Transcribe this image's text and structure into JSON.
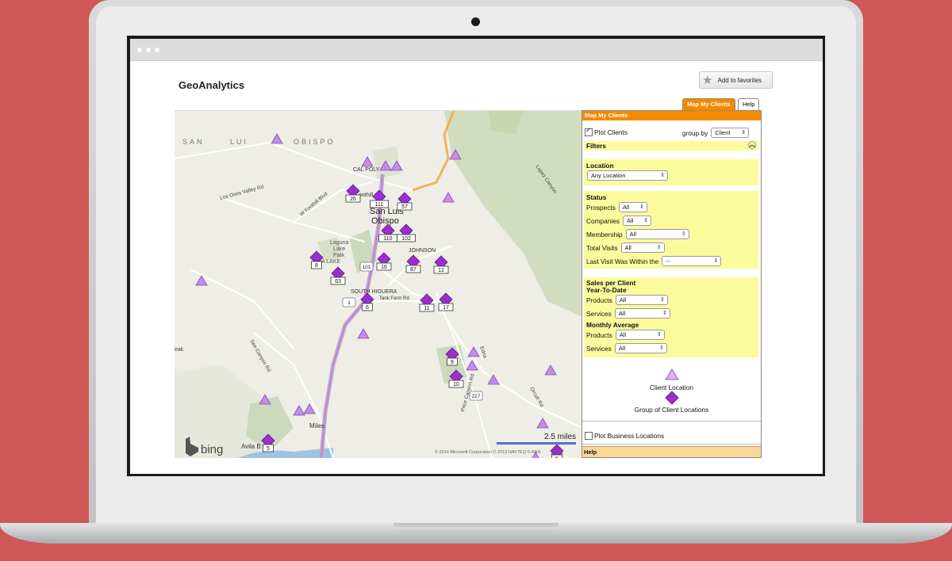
{
  "app": {
    "title": "GeoAnalytics",
    "favorites_label": "Add to favorites"
  },
  "tabs": [
    {
      "label": "Map My Clients"
    },
    {
      "label": "Help"
    }
  ],
  "panel": {
    "header": "Map My Clients",
    "plot_clients": {
      "label": "Plot Clients",
      "checked": true
    },
    "group_by": {
      "label": "group by",
      "value": "Client"
    },
    "filters_title": "Filters",
    "location": {
      "title": "Location",
      "value": "Any Location"
    },
    "status": {
      "title": "Status",
      "prospects": {
        "label": "Prospects",
        "value": "All"
      },
      "companies": {
        "label": "Companies",
        "value": "All"
      },
      "membership": {
        "label": "Membership",
        "value": "All"
      },
      "total_visits": {
        "label": "Total Visits",
        "value": "All"
      },
      "last_visit": {
        "label": "Last Visit Was Within the",
        "value": "--"
      }
    },
    "sales": {
      "title_line1": "Sales per Client",
      "title_line2": "Year-To-Date",
      "products": {
        "label": "Products",
        "value": "All"
      },
      "services": {
        "label": "Services",
        "value": "All"
      },
      "monthly_title": "Monthly Average",
      "m_products": {
        "label": "Products",
        "value": "All"
      },
      "m_services": {
        "label": "Services",
        "value": "All"
      }
    },
    "legend": {
      "client_location": "Client Location",
      "group": "Group of Client Locations"
    },
    "plot_business": {
      "label": "Plot Business Locations",
      "checked": false
    },
    "help_label": "Help"
  },
  "map": {
    "place_labels": [
      "SAN",
      "LUI",
      "OBISPO",
      "CAL POLY",
      "San Luis",
      "Obispo",
      "Laguna",
      "Lake",
      "Park",
      "NA LAKE",
      "JOHNSON",
      "SOUTH HIGUERA",
      "Tank Farm Rd",
      "Los Osos Valley Rd",
      "W Foothill Blvd",
      "See Canyon Rd",
      "Edna",
      "Orcutt Rd",
      "Price Canyon Rd",
      "Lopez Canyon",
      "Avila B",
      "Miles",
      "eak",
      "oothill"
    ],
    "route_shields": [
      "101",
      "1",
      "227"
    ],
    "clusters": [
      "26",
      "111",
      "57",
      "110",
      "102",
      "8",
      "16",
      "87",
      "12",
      "63",
      "6",
      "11",
      "17",
      "9",
      "10",
      "5",
      "6"
    ],
    "scale_label": "2.5 miles",
    "copyright": "© 2014 Microsoft Corporation   © 2013 NAVTEQ © AND",
    "logo": "bing",
    "colors": {
      "cluster": "#9b2ecf",
      "marker": "#c58be8",
      "highway": "#c3a2d3",
      "park": "#c8d8b4"
    }
  }
}
